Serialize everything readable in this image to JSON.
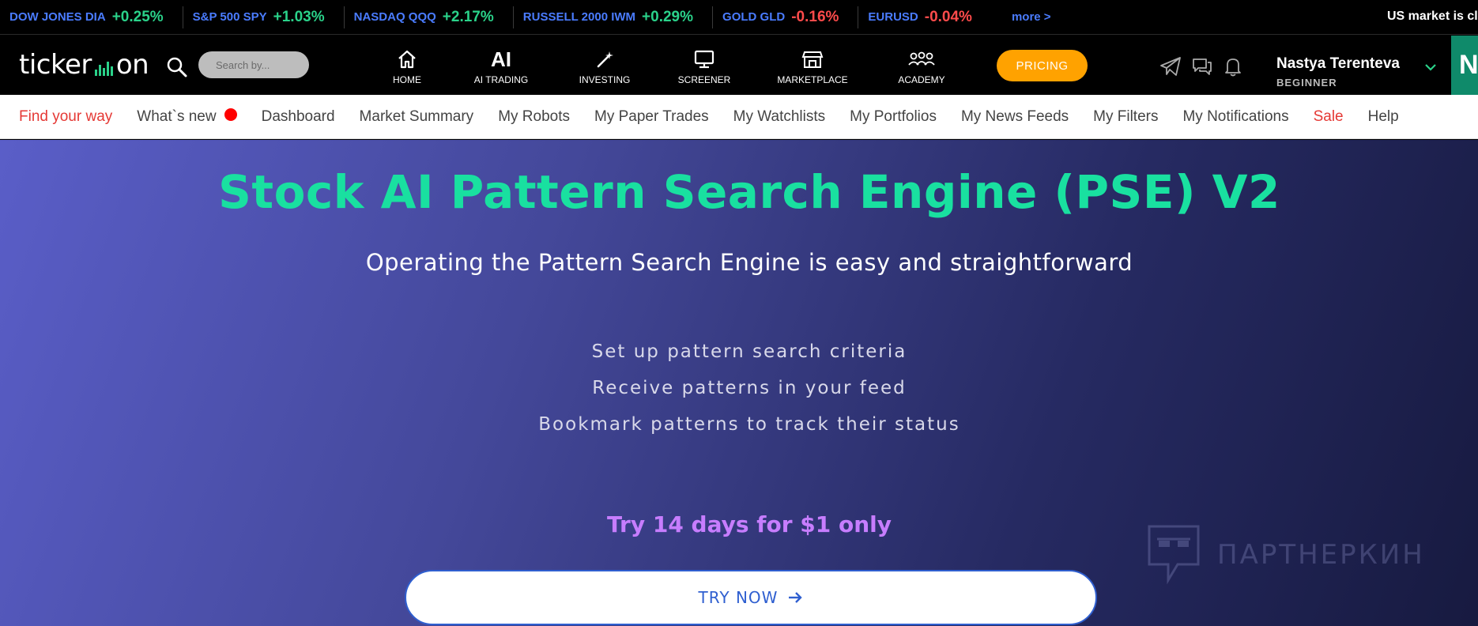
{
  "ticker": {
    "items": [
      {
        "name": "DOW JONES DIA",
        "change": "+0.25%",
        "direction": "up"
      },
      {
        "name": "S&P 500 SPY",
        "change": "+1.03%",
        "direction": "up"
      },
      {
        "name": "NASDAQ QQQ",
        "change": "+2.17%",
        "direction": "up"
      },
      {
        "name": "RUSSELL 2000 IWM",
        "change": "+0.29%",
        "direction": "up"
      },
      {
        "name": "GOLD GLD",
        "change": "-0.16%",
        "direction": "down"
      },
      {
        "name": "EURUSD",
        "change": "-0.04%",
        "direction": "down"
      }
    ],
    "more_label": "more >",
    "market_status": "US market is clo"
  },
  "header": {
    "logo_left": "ticker",
    "logo_right": "on",
    "search_placeholder": "Search by...",
    "nav": [
      {
        "label": "HOME",
        "icon": "home-icon"
      },
      {
        "label": "AI TRADING",
        "icon": "ai-icon",
        "icon_text": "AI"
      },
      {
        "label": "INVESTING",
        "icon": "magic-wand-icon"
      },
      {
        "label": "SCREENER",
        "icon": "monitor-icon"
      },
      {
        "label": "MARKETPLACE",
        "icon": "store-icon"
      },
      {
        "label": "ACADEMY",
        "icon": "group-icon"
      }
    ],
    "pricing_label": "PRICING",
    "user": {
      "name": "Nastya Terenteva",
      "level": "BEGINNER",
      "avatar_letter": "N"
    }
  },
  "subnav": {
    "items": [
      {
        "label": "Find your way",
        "highlight": true
      },
      {
        "label": "What`s new",
        "highlight": false,
        "dot": true
      },
      {
        "label": "Dashboard",
        "highlight": false
      },
      {
        "label": "Market Summary",
        "highlight": false
      },
      {
        "label": "My Robots",
        "highlight": false
      },
      {
        "label": "My Paper Trades",
        "highlight": false
      },
      {
        "label": "My Watchlists",
        "highlight": false
      },
      {
        "label": "My Portfolios",
        "highlight": false
      },
      {
        "label": "My News Feeds",
        "highlight": false
      },
      {
        "label": "My Filters",
        "highlight": false
      },
      {
        "label": "My Notifications",
        "highlight": false
      },
      {
        "label": "Sale",
        "highlight": true
      },
      {
        "label": "Help",
        "highlight": false
      }
    ]
  },
  "hero": {
    "title": "Stock AI Pattern Search Engine (PSE) V2",
    "subtitle": "Operating the Pattern Search Engine is easy and straightforward",
    "steps": [
      "Set up pattern search criteria",
      "Receive patterns in your feed",
      "Bookmark patterns to track their status"
    ],
    "promo": "Try 14 days for $1 only",
    "cta_label": "TRY NOW",
    "watermark_text": "ПАРТНЕРКИН"
  },
  "colors": {
    "accent_green": "#19e0a0",
    "up": "#2ad28a",
    "down": "#ff4b4b",
    "ticker_name": "#4a7cff",
    "pricing": "#ffa200",
    "promo": "#c77dff",
    "cta_border": "#2f5fd0"
  }
}
